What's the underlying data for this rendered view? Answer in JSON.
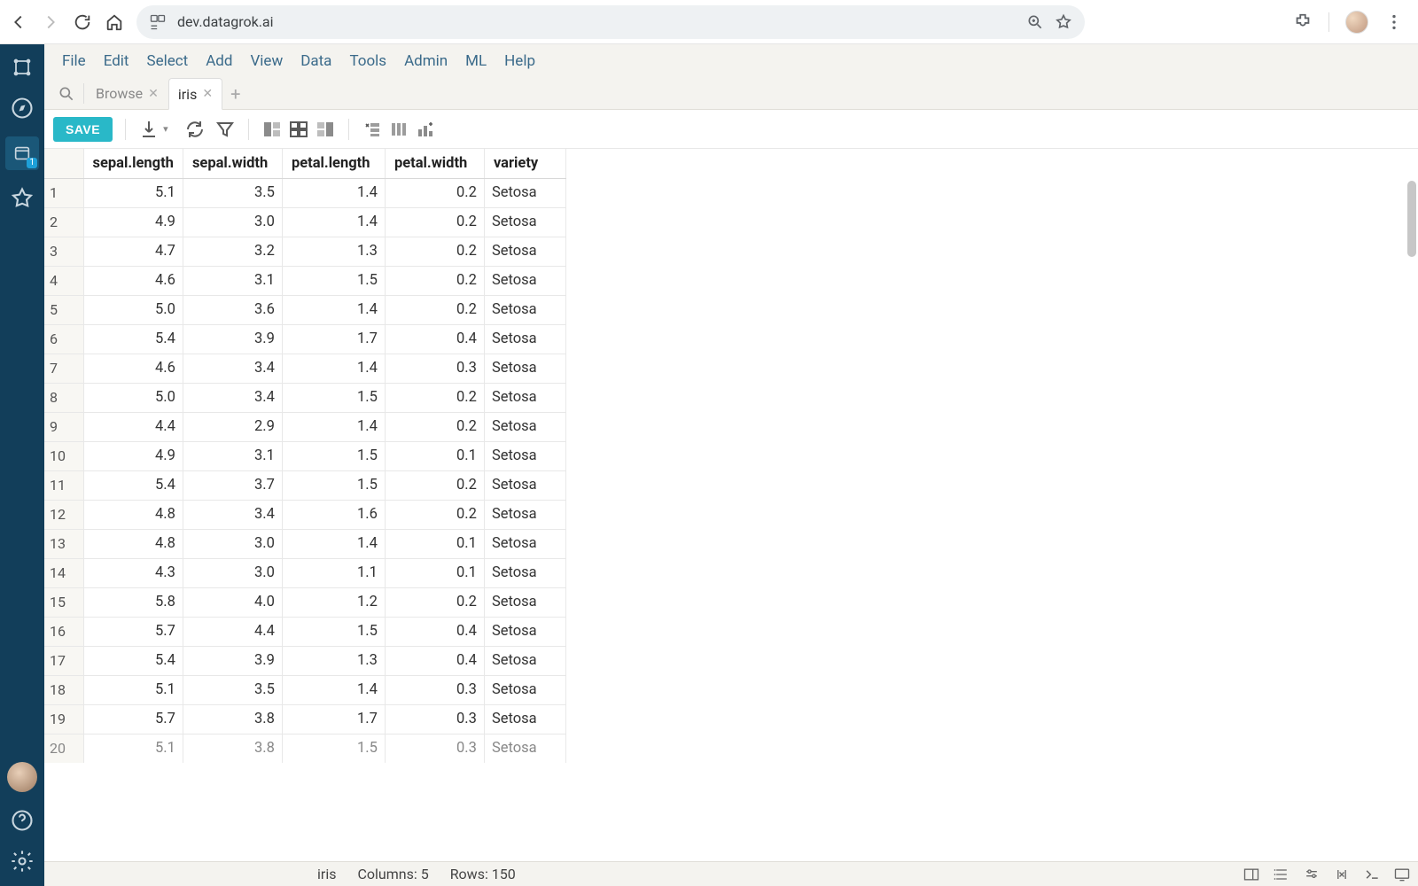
{
  "browser": {
    "url": "dev.datagrok.ai"
  },
  "menubar": [
    "File",
    "Edit",
    "Select",
    "Add",
    "View",
    "Data",
    "Tools",
    "Admin",
    "ML",
    "Help"
  ],
  "tabs": [
    {
      "label": "Browse",
      "active": false
    },
    {
      "label": "iris",
      "active": true
    }
  ],
  "toolbar": {
    "save_label": "SAVE"
  },
  "grid": {
    "columns": [
      "sepal.length",
      "sepal.width",
      "petal.length",
      "petal.width",
      "variety"
    ],
    "rows": [
      {
        "n": "1",
        "sl": "5.1",
        "sw": "3.5",
        "pl": "1.4",
        "pw": "0.2",
        "v": "Setosa"
      },
      {
        "n": "2",
        "sl": "4.9",
        "sw": "3.0",
        "pl": "1.4",
        "pw": "0.2",
        "v": "Setosa"
      },
      {
        "n": "3",
        "sl": "4.7",
        "sw": "3.2",
        "pl": "1.3",
        "pw": "0.2",
        "v": "Setosa"
      },
      {
        "n": "4",
        "sl": "4.6",
        "sw": "3.1",
        "pl": "1.5",
        "pw": "0.2",
        "v": "Setosa"
      },
      {
        "n": "5",
        "sl": "5.0",
        "sw": "3.6",
        "pl": "1.4",
        "pw": "0.2",
        "v": "Setosa"
      },
      {
        "n": "6",
        "sl": "5.4",
        "sw": "3.9",
        "pl": "1.7",
        "pw": "0.4",
        "v": "Setosa"
      },
      {
        "n": "7",
        "sl": "4.6",
        "sw": "3.4",
        "pl": "1.4",
        "pw": "0.3",
        "v": "Setosa"
      },
      {
        "n": "8",
        "sl": "5.0",
        "sw": "3.4",
        "pl": "1.5",
        "pw": "0.2",
        "v": "Setosa"
      },
      {
        "n": "9",
        "sl": "4.4",
        "sw": "2.9",
        "pl": "1.4",
        "pw": "0.2",
        "v": "Setosa"
      },
      {
        "n": "10",
        "sl": "4.9",
        "sw": "3.1",
        "pl": "1.5",
        "pw": "0.1",
        "v": "Setosa"
      },
      {
        "n": "11",
        "sl": "5.4",
        "sw": "3.7",
        "pl": "1.5",
        "pw": "0.2",
        "v": "Setosa"
      },
      {
        "n": "12",
        "sl": "4.8",
        "sw": "3.4",
        "pl": "1.6",
        "pw": "0.2",
        "v": "Setosa"
      },
      {
        "n": "13",
        "sl": "4.8",
        "sw": "3.0",
        "pl": "1.4",
        "pw": "0.1",
        "v": "Setosa"
      },
      {
        "n": "14",
        "sl": "4.3",
        "sw": "3.0",
        "pl": "1.1",
        "pw": "0.1",
        "v": "Setosa"
      },
      {
        "n": "15",
        "sl": "5.8",
        "sw": "4.0",
        "pl": "1.2",
        "pw": "0.2",
        "v": "Setosa"
      },
      {
        "n": "16",
        "sl": "5.7",
        "sw": "4.4",
        "pl": "1.5",
        "pw": "0.4",
        "v": "Setosa"
      },
      {
        "n": "17",
        "sl": "5.4",
        "sw": "3.9",
        "pl": "1.3",
        "pw": "0.4",
        "v": "Setosa"
      },
      {
        "n": "18",
        "sl": "5.1",
        "sw": "3.5",
        "pl": "1.4",
        "pw": "0.3",
        "v": "Setosa"
      },
      {
        "n": "19",
        "sl": "5.7",
        "sw": "3.8",
        "pl": "1.7",
        "pw": "0.3",
        "v": "Setosa"
      },
      {
        "n": "20",
        "sl": "5.1",
        "sw": "3.8",
        "pl": "1.5",
        "pw": "0.3",
        "v": "Setosa"
      }
    ]
  },
  "status": {
    "dataset": "iris",
    "columns": "Columns: 5",
    "rows": "Rows: 150"
  },
  "sidebar": {
    "projects_badge": "1"
  }
}
